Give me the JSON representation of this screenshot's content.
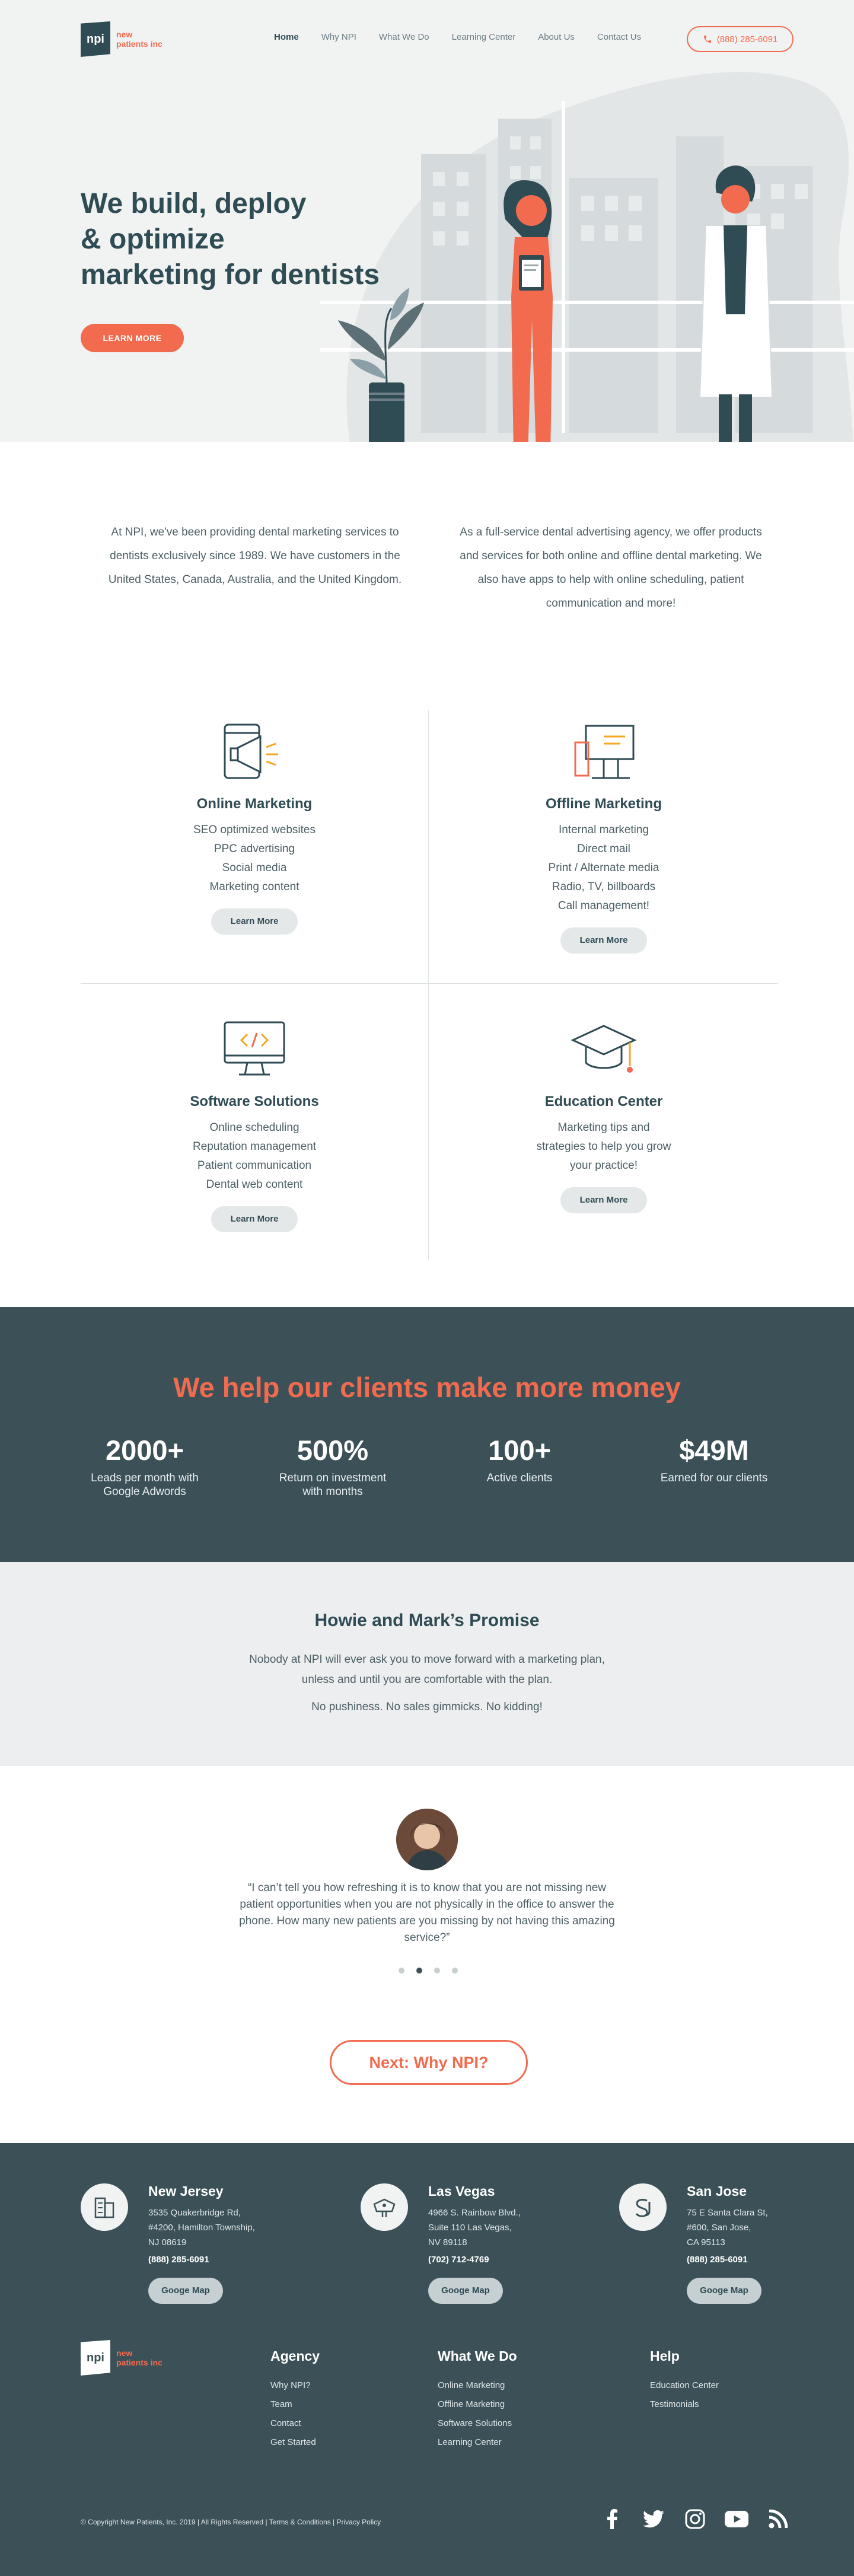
{
  "header": {
    "logo_abbr": "npi",
    "logo_line1": "new",
    "logo_line2": "patients inc",
    "nav": [
      "Home",
      "Why NPI",
      "What We Do",
      "Learning Center",
      "About Us",
      "Contact Us"
    ],
    "phone": "(888) 285-6091"
  },
  "hero": {
    "title_line1": "We build, deploy",
    "title_line2": "& optimize",
    "title_line3": "marketing for dentists",
    "cta": "LEARN MORE"
  },
  "intro": {
    "left": "At NPI,  we've been providing dental marketing services to dentists exclusively since 1989. We have customers in the United States, Canada, Australia, and the United Kingdom.",
    "right": "As a full-service dental advertising agency, we offer products and services for both online and offline dental marketing. We also have apps to help with online scheduling, patient communication and more!"
  },
  "services": [
    {
      "title": "Online Marketing",
      "lines": [
        "SEO optimized websites",
        "PPC advertising",
        "Social media",
        "Marketing content"
      ],
      "button": "Learn More",
      "icon": "megaphone-icon"
    },
    {
      "title": "Offline Marketing",
      "lines": [
        "Internal marketing",
        "Direct mail",
        "Print / Alternate media",
        "Radio, TV, billboards",
        "Call management!"
      ],
      "button": "Learn More",
      "icon": "billboard-icon"
    },
    {
      "title": "Software Solutions",
      "lines": [
        "Online scheduling",
        "Reputation management",
        "Patient communication",
        "Dental web content"
      ],
      "button": "Learn More",
      "icon": "monitor-code-icon"
    },
    {
      "title": "Education Center",
      "lines": [
        "Marketing tips and",
        "strategies to help you grow",
        "your practice!"
      ],
      "button": "Learn More",
      "icon": "graduation-cap-icon"
    }
  ],
  "stats": {
    "title": "We help our clients make more money",
    "items": [
      {
        "value": "2000+",
        "label_line1": "Leads per month with",
        "label_line2": "Google Adwords"
      },
      {
        "value": "500%",
        "label_line1": "Return on investment",
        "label_line2": "with months"
      },
      {
        "value": "100+",
        "label_line1": "Active clients",
        "label_line2": ""
      },
      {
        "value": "$49M",
        "label_line1": "Earned for our clients",
        "label_line2": ""
      }
    ]
  },
  "promise": {
    "title": "Howie and Mark’s Promise",
    "line1": "Nobody at NPI will ever ask you to move forward with a marketing plan,",
    "line2": "unless and until you are comfortable with the plan.",
    "line3": "No pushiness. No sales gimmicks. No kidding!"
  },
  "testimonial": {
    "quote": "“I can’t tell you how refreshing it is to know that you are not missing new patient opportunities when you are not physically in the office to answer the phone. How many new patients are you missing by not having this amazing service?”",
    "active_dot": 2,
    "dot_count": 4
  },
  "next_button": "Next: Why NPI?",
  "offices": [
    {
      "name": "New Jersey",
      "addr1": "3535 Quakerbridge Rd,",
      "addr2": "#4200, Hamilton Township,",
      "addr3": "NJ 08619",
      "phone": "(888) 285-6091",
      "button": "Googe Map",
      "icon": "building-icon"
    },
    {
      "name": "Las Vegas",
      "addr1": "4966 S. Rainbow Blvd.,",
      "addr2": "Suite 110 Las Vegas,",
      "addr3": "NV 89118",
      "phone": "(702) 712-4769",
      "button": "Googe Map",
      "icon": "vegas-sign-icon"
    },
    {
      "name": "San Jose",
      "addr1": "75 E Santa Clara St,",
      "addr2": "#600, San Jose,",
      "addr3": "CA 95113",
      "phone": "(888) 285-6091",
      "button": "Googe Map",
      "icon": "sj-monogram-icon"
    }
  ],
  "footer_cols": [
    {
      "title": "Agency",
      "links": [
        "Why NPI?",
        "Team",
        "Contact",
        "Get Started"
      ]
    },
    {
      "title": "What We Do",
      "links": [
        "Online Marketing",
        "Offline Marketing",
        "Software Solutions",
        "Learning Center"
      ]
    },
    {
      "title": "Help",
      "links": [
        "Education Center",
        "Testimonials"
      ]
    }
  ],
  "copyright": "© Copyright New Patients, Inc. 2019  |  All Rights Reserved  |  Terms & Conditions  |     Privacy Policy",
  "social": [
    "facebook-icon",
    "twitter-icon",
    "instagram-icon",
    "youtube-icon",
    "rss-icon"
  ],
  "colors": {
    "accent": "#f26b4f",
    "dark": "#3b5157",
    "heading": "#2f4b54",
    "light_bg": "#f1f3f3"
  }
}
